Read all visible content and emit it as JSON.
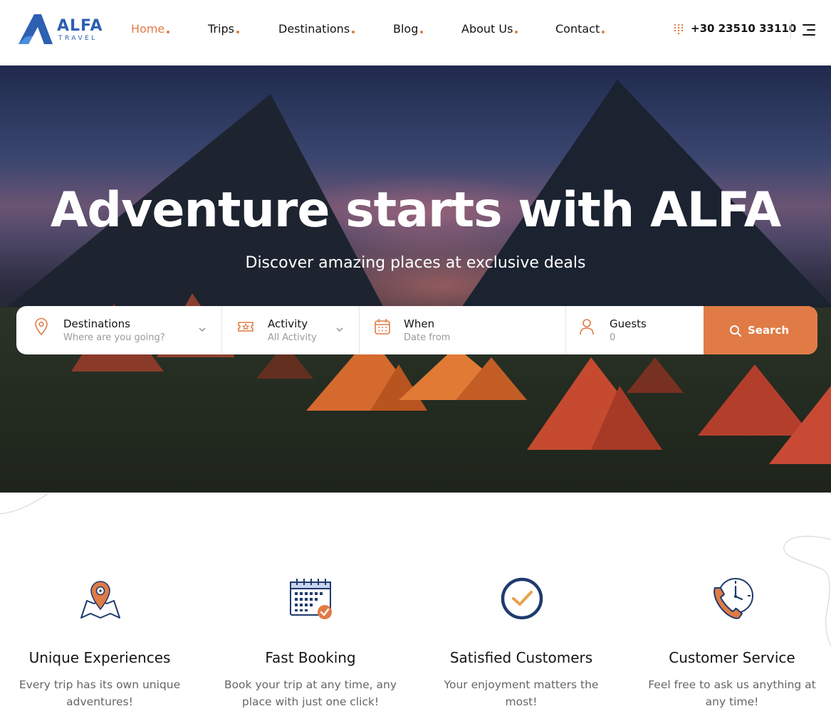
{
  "brand": {
    "name": "ALFA",
    "tagline": "TRAVEL",
    "accent": "#e07b45",
    "primary": "#2d5fb2"
  },
  "nav": {
    "items": [
      {
        "label": "Home",
        "active": true
      },
      {
        "label": "Trips",
        "active": false
      },
      {
        "label": "Destinations",
        "active": false
      },
      {
        "label": "Blog",
        "active": false
      },
      {
        "label": "About Us",
        "active": false
      },
      {
        "label": "Contact",
        "active": false
      }
    ],
    "phone": "+30 23510 33110"
  },
  "hero": {
    "title": "Adventure starts with ALFA",
    "subtitle": "Discover amazing places at exclusive deals"
  },
  "search": {
    "fields": [
      {
        "label": "Destinations",
        "value": "Where are you going?",
        "icon": "map-pin-icon"
      },
      {
        "label": "Activity",
        "value": "All Activity",
        "icon": "ticket-icon"
      },
      {
        "label": "When",
        "value": "Date from",
        "icon": "calendar-icon"
      },
      {
        "label": "Guests",
        "value": "0",
        "icon": "user-icon"
      }
    ],
    "button_label": "Search"
  },
  "features": [
    {
      "title": "Unique Experiences",
      "desc": "Every trip has its own unique adventures!",
      "icon": "map-location-icon"
    },
    {
      "title": "Fast Booking",
      "desc": "Book your trip at any time, any place with just one click!",
      "icon": "calendar-check-icon"
    },
    {
      "title": "Satisfied Customers",
      "desc": "Your enjoyment matters the most!",
      "icon": "check-circle-icon"
    },
    {
      "title": "Customer Service",
      "desc": "Feel free to ask us anything at any time!",
      "icon": "phone-clock-icon"
    }
  ]
}
